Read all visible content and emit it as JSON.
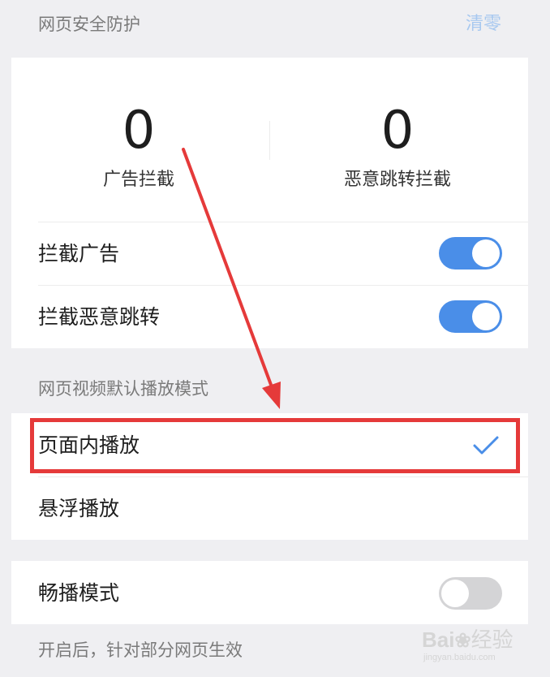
{
  "web_security": {
    "title": "网页安全防护",
    "clear_label": "清零",
    "ad_block_count": "0",
    "ad_block_label": "广告拦截",
    "redirect_block_count": "0",
    "redirect_block_label": "恶意跳转拦截",
    "toggles": [
      {
        "label": "拦截广告",
        "on": true
      },
      {
        "label": "拦截恶意跳转",
        "on": true
      }
    ]
  },
  "video_mode": {
    "title": "网页视频默认播放模式",
    "options": [
      {
        "label": "页面内播放",
        "selected": true
      },
      {
        "label": "悬浮播放",
        "selected": false
      }
    ]
  },
  "smooth_play": {
    "label": "畅播模式",
    "on": false,
    "description": "开启后，针对部分网页生效"
  },
  "watermark": {
    "text_main": "Bai",
    "text_after": "经验",
    "text_sub": "jingyan.baidu.com"
  },
  "colors": {
    "accent": "#4a8ee8",
    "highlight": "#e53a3a",
    "toggle_off": "#d4d4d6",
    "clear_link": "#a7c8f0"
  }
}
